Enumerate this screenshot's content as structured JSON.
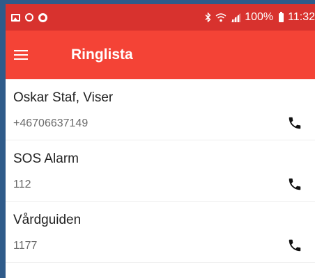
{
  "status_bar": {
    "left_icons": [
      "image-icon",
      "ring-icon",
      "disc-icon"
    ],
    "right_icons": [
      "bluetooth-icon",
      "wifi-icon",
      "signal-icon",
      "battery-icon"
    ],
    "battery_text": "100%",
    "time": "11:32",
    "background_color": "#d8322e"
  },
  "app_bar": {
    "title": "Ringlista",
    "menu_icon": "menu-icon",
    "background_color": "#f44336"
  },
  "contacts": [
    {
      "name": "Oskar Staf, Viser",
      "number": "+46706637149",
      "icon": "phone-icon"
    },
    {
      "name": "SOS Alarm",
      "number": "112",
      "icon": "phone-icon"
    },
    {
      "name": "Vårdguiden",
      "number": "1177",
      "icon": "phone-icon"
    }
  ]
}
